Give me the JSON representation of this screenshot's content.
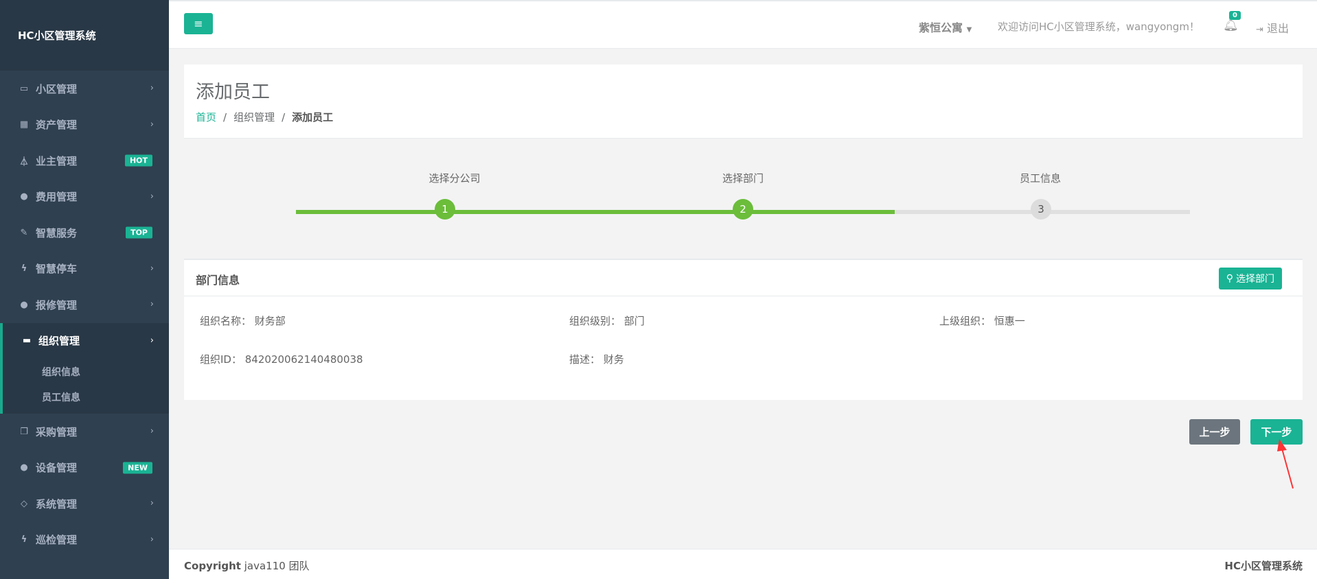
{
  "app": {
    "brand": "HC小区管理系统"
  },
  "sidebar": {
    "items": [
      {
        "label": "小区管理",
        "icon": "laptop-icon"
      },
      {
        "label": "资产管理",
        "icon": "grid-icon"
      },
      {
        "label": "业主管理",
        "icon": "flask-icon",
        "badge": "HOT"
      },
      {
        "label": "费用管理",
        "icon": "globe-icon"
      },
      {
        "label": "智慧服务",
        "icon": "edit-icon",
        "badge": "TOP"
      },
      {
        "label": "智慧停车",
        "icon": "bolt-icon"
      },
      {
        "label": "报修管理",
        "icon": "globe-icon"
      },
      {
        "label": "组织管理",
        "icon": "desktop-icon",
        "active": true
      },
      {
        "label": "采购管理",
        "icon": "copy-icon"
      },
      {
        "label": "设备管理",
        "icon": "globe-icon",
        "badge": "NEW"
      },
      {
        "label": "系统管理",
        "icon": "diamond-icon"
      },
      {
        "label": "巡检管理",
        "icon": "bolt-icon"
      }
    ],
    "sub_items": [
      "组织信息",
      "员工信息"
    ]
  },
  "topbar": {
    "community": "紫恒公寓",
    "welcome": "欢迎访问HC小区管理系统，wangyongm！",
    "notification_count": "0",
    "logout": "退出"
  },
  "page": {
    "title": "添加员工",
    "breadcrumb": [
      "首页",
      "组织管理",
      "添加员工"
    ]
  },
  "steps": {
    "labels": [
      "选择分公司",
      "选择部门",
      "员工信息"
    ],
    "numbers": [
      "1",
      "2",
      "3"
    ],
    "completed": 2,
    "progress_percent": 67
  },
  "department": {
    "title": "部门信息",
    "select_button": "选择部门",
    "name_label": "组织名称：",
    "name_value": "财务部",
    "level_label": "组织级别：",
    "level_value": "部门",
    "parent_label": "上级组织：",
    "parent_value": "恒惠一",
    "id_label": "组织ID：",
    "id_value": "842020062140480038",
    "desc_label": "描述：",
    "desc_value": "财务"
  },
  "actions": {
    "prev": "上一步",
    "next": "下一步"
  },
  "footer": {
    "copyright_prefix": "Copyright",
    "copyright_team": "java110 团队",
    "right": "HC小区管理系统"
  },
  "colors": {
    "accent": "#1ab394",
    "sidebar": "#2f4050",
    "progress": "#6bbd3a",
    "annotation": "#ff3333"
  }
}
